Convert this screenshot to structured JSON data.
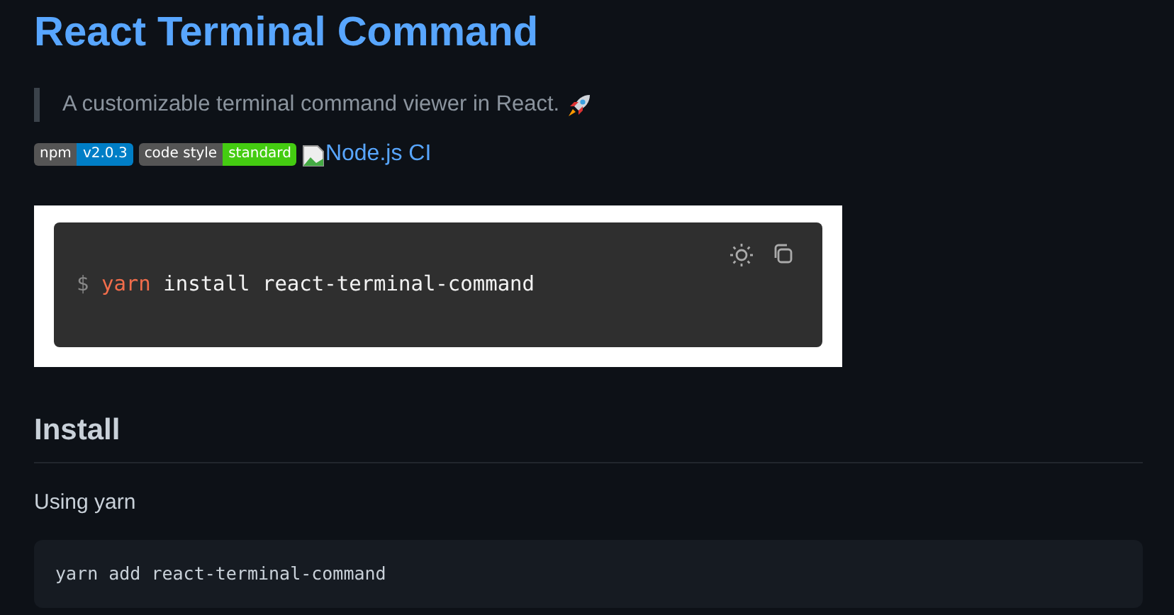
{
  "title": "React Terminal Command",
  "description": "A customizable terminal command viewer in React.",
  "badges": [
    {
      "label": "npm",
      "value": "v2.0.3",
      "color": "#007ec6"
    },
    {
      "label": "code style",
      "value": "standard",
      "color": "#44cc11"
    }
  ],
  "broken_image_link": "Node.js CI",
  "terminal": {
    "prompt": "$",
    "program": "yarn",
    "args": "install react-terminal-command"
  },
  "section": {
    "heading": "Install",
    "text": "Using yarn",
    "code": "yarn add react-terminal-command"
  }
}
